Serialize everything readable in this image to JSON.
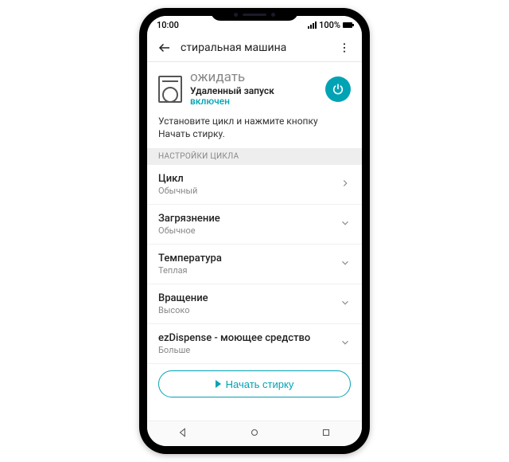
{
  "statusbar": {
    "time": "10:00",
    "battery_pct": "100%"
  },
  "appbar": {
    "title": "стиральная машина"
  },
  "status": {
    "main": "ожидать",
    "sub": "Удаленный запуск",
    "enabled": "включен"
  },
  "instruction": "Установите цикл и нажмите кнопку Начать стирку.",
  "section_header": "НАСТРОЙКИ ЦИКЛА",
  "settings": [
    {
      "label": "Цикл",
      "value": "Обычный",
      "arrow": "right"
    },
    {
      "label": "Загрязнение",
      "value": "Обычное",
      "arrow": "down"
    },
    {
      "label": "Температура",
      "value": "Теплая",
      "arrow": "down"
    },
    {
      "label": "Вращение",
      "value": "Высоко",
      "arrow": "down"
    },
    {
      "label": "ezDispense - моющее средство",
      "value": "Больше",
      "arrow": "down"
    }
  ],
  "start_button": "Начать стирку",
  "colors": {
    "accent": "#00a3b4"
  }
}
